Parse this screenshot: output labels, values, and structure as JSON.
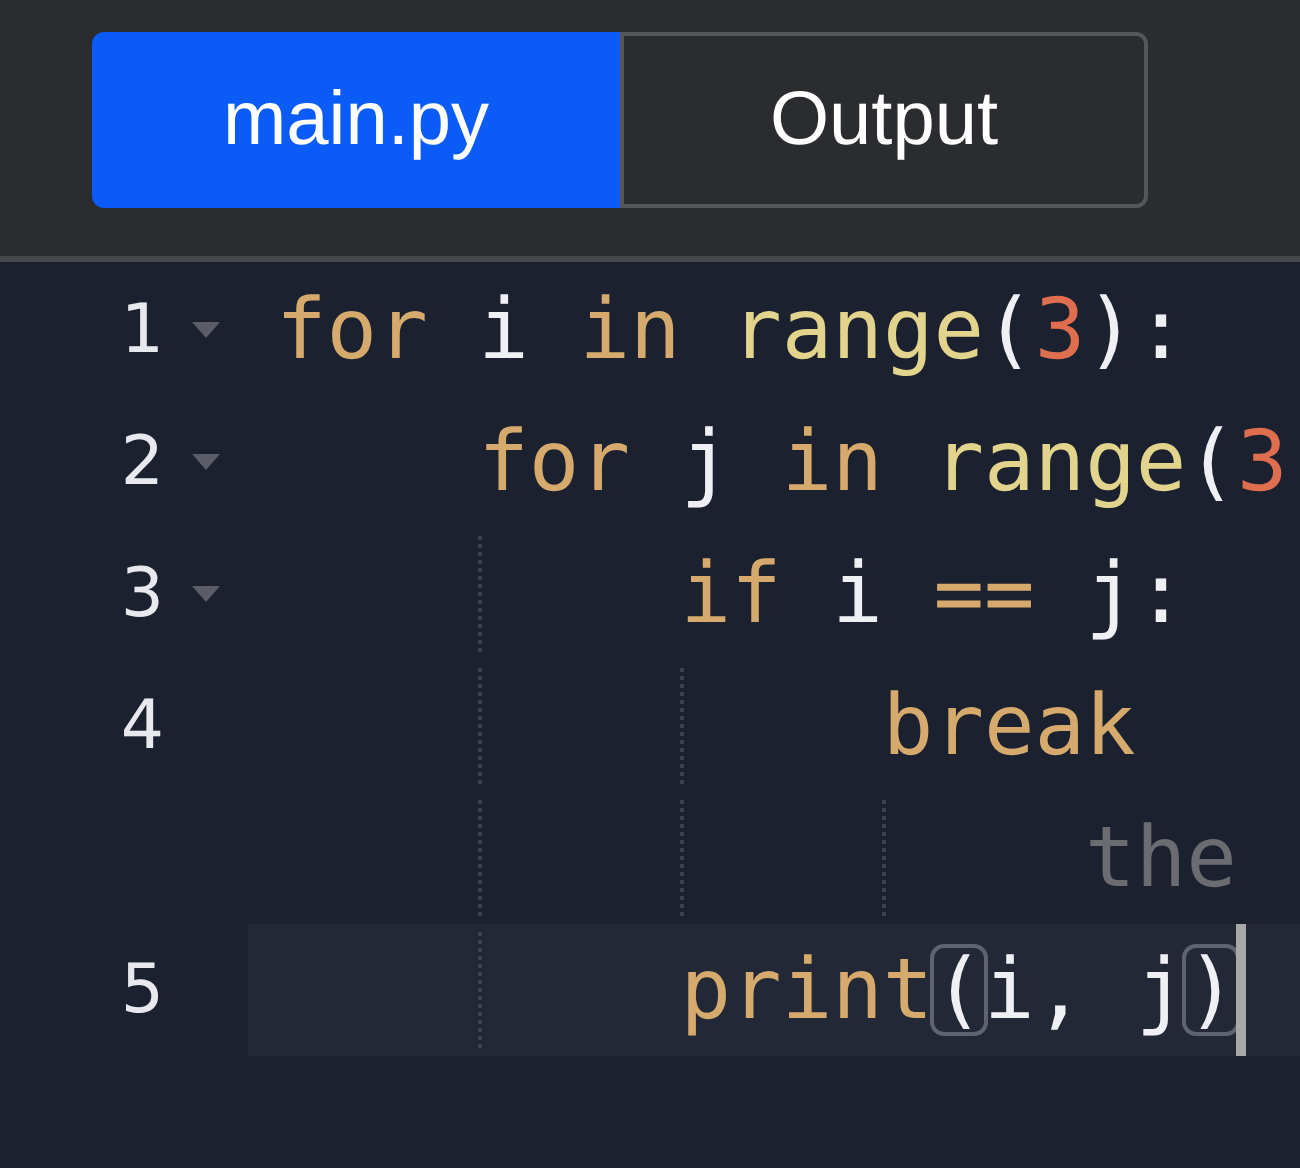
{
  "tabs": [
    {
      "label": "main.py",
      "selected": true
    },
    {
      "label": "Output",
      "selected": false
    }
  ],
  "lines": [
    {
      "kind": "code",
      "number": "1",
      "foldable": true,
      "cursor": false,
      "tokens": [
        {
          "kind": "keyword",
          "text": "for "
        },
        {
          "kind": "name",
          "text": "i "
        },
        {
          "kind": "keyword",
          "text": "in "
        },
        {
          "kind": "function",
          "text": "range"
        },
        {
          "kind": "punct",
          "text": "("
        },
        {
          "kind": "number",
          "text": "3"
        },
        {
          "kind": "punct",
          "text": "):"
        }
      ],
      "children": [
        {
          "kind": "code",
          "number": "2",
          "foldable": true,
          "cursor": false,
          "tokens": [
            {
              "kind": "keyword",
              "text": "for "
            },
            {
              "kind": "name",
              "text": "j "
            },
            {
              "kind": "keyword",
              "text": "in "
            },
            {
              "kind": "function",
              "text": "range"
            },
            {
              "kind": "punct",
              "text": "("
            },
            {
              "kind": "number",
              "text": "3"
            }
          ],
          "children": [
            {
              "kind": "code",
              "number": "3",
              "foldable": true,
              "cursor": false,
              "tokens": [
                {
                  "kind": "keyword",
                  "text": "if "
                },
                {
                  "kind": "name",
                  "text": "i "
                },
                {
                  "kind": "keyword",
                  "text": "== "
                },
                {
                  "kind": "name",
                  "text": "j:"
                }
              ],
              "children": [
                {
                  "kind": "code",
                  "number": "4",
                  "foldable": false,
                  "cursor": false,
                  "tokens": [
                    {
                      "kind": "keyword",
                      "text": "break"
                    }
                  ],
                  "children": [
                    {
                      "kind": "hint",
                      "tokens": [
                        {
                          "kind": "hint",
                          "text": "the"
                        }
                      ]
                    }
                  ]
                }
              ]
            },
            {
              "kind": "code",
              "number": "5",
              "foldable": false,
              "cursor": true,
              "tokens": [
                {
                  "kind": "keyword",
                  "text": "print"
                },
                {
                  "kind": "punct",
                  "text": "(",
                  "matched": true
                },
                {
                  "kind": "name",
                  "text": "i, j"
                },
                {
                  "kind": "punct",
                  "text": ")",
                  "matched": true
                }
              ]
            }
          ]
        }
      ]
    }
  ]
}
